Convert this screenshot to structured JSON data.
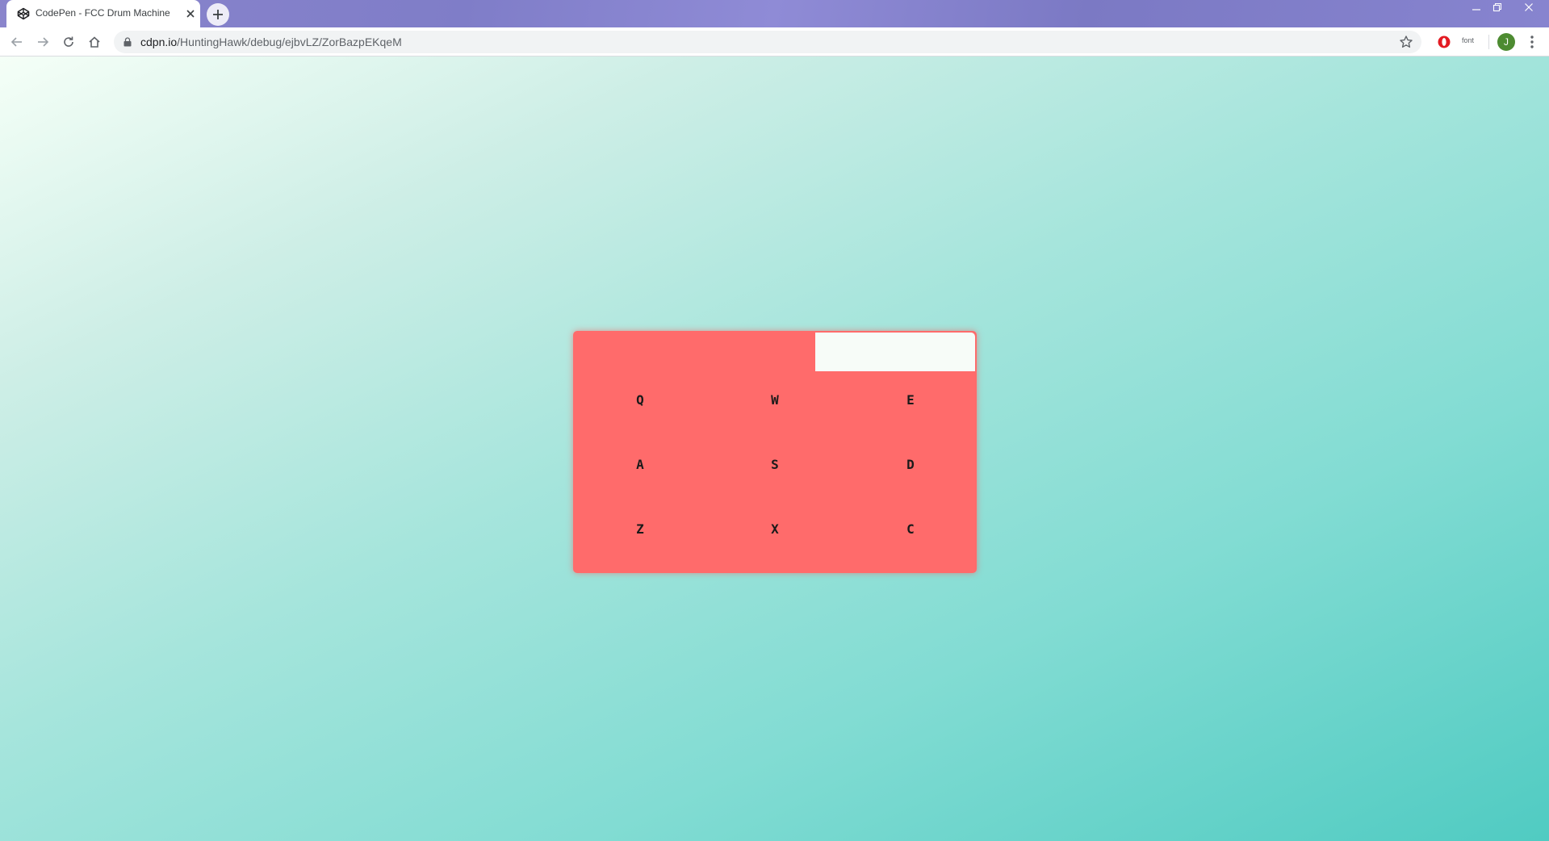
{
  "browser": {
    "tab": {
      "title": "CodePen - FCC Drum Machine"
    },
    "address": {
      "host": "cdpn.io",
      "path": "/HuntingHawk/debug/ejbvLZ/ZorBazpEKqeM"
    },
    "extensions": {
      "font_label": "font"
    },
    "profile_initial": "J"
  },
  "app": {
    "display_text": "",
    "pads": [
      {
        "key": "Q"
      },
      {
        "key": "W"
      },
      {
        "key": "E"
      },
      {
        "key": "A"
      },
      {
        "key": "S"
      },
      {
        "key": "D"
      },
      {
        "key": "Z"
      },
      {
        "key": "X"
      },
      {
        "key": "C"
      }
    ],
    "colors": {
      "machine": "#ff6b6b",
      "display": "#f7fcf8",
      "bg_start": "#f5fff7",
      "bg_end": "#50cbc2",
      "titlebar": "#8a85cc"
    }
  }
}
